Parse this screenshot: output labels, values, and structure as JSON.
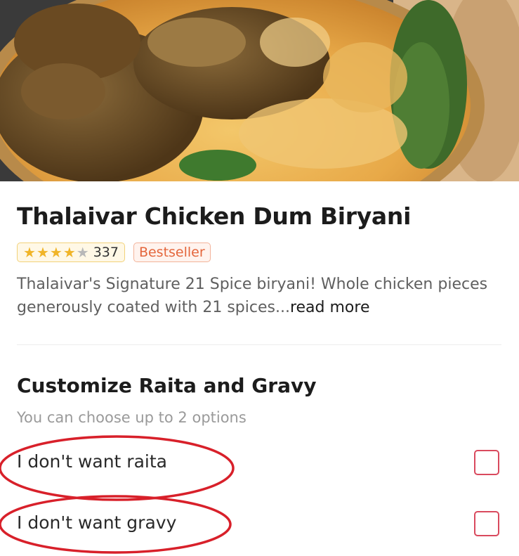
{
  "item": {
    "name": "Thalaivar Chicken Dum Biryani",
    "rating_stars": 4,
    "rating_max": 5,
    "rating_count": "337",
    "badge": "Bestseller",
    "description": "Thalaivar's Signature 21 Spice biryani! Whole chicken pieces generously coated with 21 spices...",
    "read_more": "read more"
  },
  "customize": {
    "title": "Customize Raita and Gravy",
    "subtitle": "You can choose up to 2 options",
    "options": [
      {
        "label": "I don't want raita",
        "checked": false
      },
      {
        "label": "I don't want gravy",
        "checked": false
      }
    ]
  },
  "colors": {
    "star": "#f0b428",
    "bestseller": "#e4663c",
    "checkbox": "#d94a5e",
    "annotation": "#d8202a"
  },
  "icons": [
    "star-icon",
    "checkbox-icon"
  ]
}
